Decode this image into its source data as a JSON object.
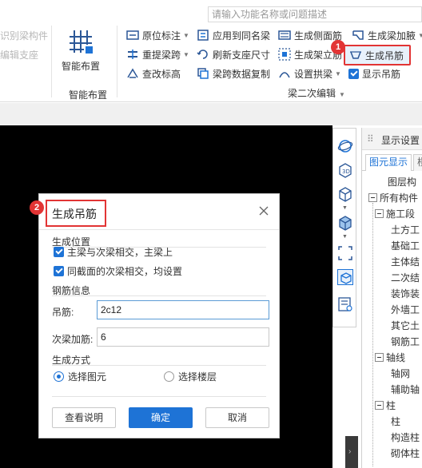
{
  "ribbon": {
    "search_placeholder": "请输入功能名称或问题描述",
    "left_cut_1": "识别梁构件",
    "left_cut_2": "编辑支座",
    "big_button_label": "智能布置",
    "group_label_smart": "智能布置",
    "col1": [
      "原位标注",
      "重提梁跨",
      "查改标高"
    ],
    "col2": [
      "应用到同名梁",
      "刷新支座尺寸",
      "梁跨数据复制"
    ],
    "col3": [
      "生成侧面筋",
      "生成架立筋",
      "设置拱梁"
    ],
    "col4_top": "生成梁加腋",
    "highlight_button": "生成吊筋",
    "show_hanger_checkbox": "显示吊筋",
    "group_label_edit": "梁二次编辑",
    "badge_1": "1"
  },
  "panel": {
    "title": "显示设置",
    "tab_active": "图元显示",
    "tab_other": "楼",
    "tree_header": "图层构",
    "tree": [
      {
        "label": "所有构件",
        "level": 0,
        "expandable": true
      },
      {
        "label": "施工段",
        "level": 1,
        "expandable": true
      },
      {
        "label": "土方工",
        "level": 2,
        "expandable": false
      },
      {
        "label": "基础工",
        "level": 2,
        "expandable": false
      },
      {
        "label": "主体结",
        "level": 2,
        "expandable": false
      },
      {
        "label": "二次结",
        "level": 2,
        "expandable": false
      },
      {
        "label": "装饰装",
        "level": 2,
        "expandable": false
      },
      {
        "label": "外墙工",
        "level": 2,
        "expandable": false
      },
      {
        "label": "其它土",
        "level": 2,
        "expandable": false
      },
      {
        "label": "钢筋工",
        "level": 2,
        "expandable": false
      },
      {
        "label": "轴线",
        "level": 1,
        "expandable": true
      },
      {
        "label": "轴网",
        "level": 2,
        "expandable": false
      },
      {
        "label": "辅助轴",
        "level": 2,
        "expandable": false
      },
      {
        "label": "柱",
        "level": 1,
        "expandable": true
      },
      {
        "label": "柱",
        "level": 2,
        "expandable": false
      },
      {
        "label": "构造柱",
        "level": 2,
        "expandable": false
      },
      {
        "label": "砌体柱",
        "level": 2,
        "expandable": false
      }
    ]
  },
  "dialog": {
    "title": "生成吊筋",
    "badge_2": "2",
    "section_position": "生成位置",
    "cb1": "主梁与次梁相交，主梁上",
    "cb2": "同截面的次梁相交，均设置",
    "section_rebar": "钢筋信息",
    "hanger_label": "吊筋:",
    "hanger_value": "2c12",
    "secondary_label": "次梁加筋:",
    "secondary_value": "6",
    "section_method": "生成方式",
    "radio1": "选择图元",
    "radio2": "选择楼层",
    "btn_help": "查看说明",
    "btn_ok": "确定",
    "btn_cancel": "取消"
  },
  "colors": {
    "accent": "#1e73d6",
    "highlight_red": "#e23434",
    "canvas": "#000000"
  }
}
